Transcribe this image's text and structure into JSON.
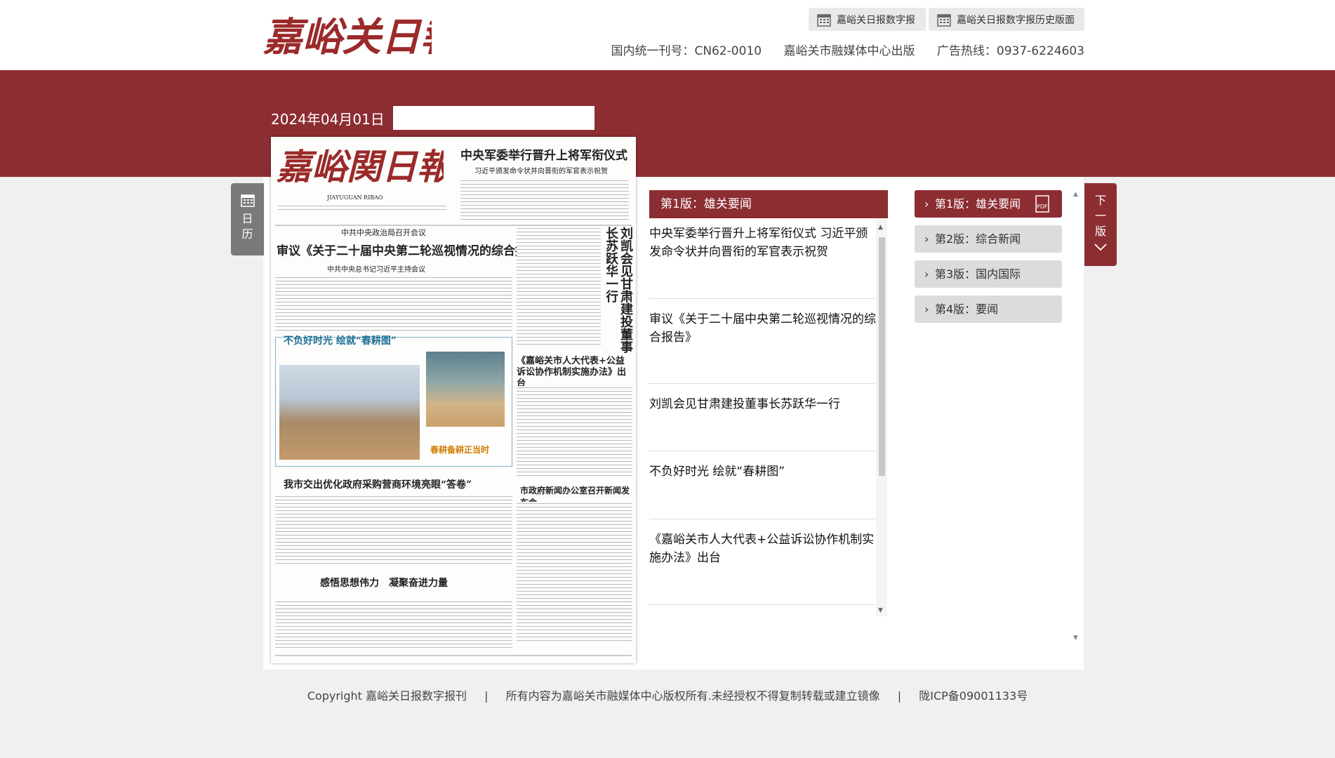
{
  "header": {
    "logo_text": "嘉峪关日報",
    "btn_digital": "嘉峪关日报数字报",
    "btn_history": "嘉峪关日报数字报历史版面",
    "issn": "国内统一刊号：CN62-0010",
    "publisher": "嘉峪关市融媒体中心出版",
    "hotline": "广告热线：0937-6224603"
  },
  "date": "2024年04月01日",
  "side_calendar": {
    "line1": "日",
    "line2": "历"
  },
  "next_page": {
    "line1": "下",
    "line2": "一",
    "line3": "版"
  },
  "paper": {
    "masthead": "嘉峪関日報",
    "pinyin": "JIAYUGUAN RIBAO",
    "headline_top": "中央军委举行晋升上将军衔仪式",
    "sub_top": "习近平颁发命令状并向晋衔的军官表示祝贺",
    "kicker": "中共中央政治局召开会议",
    "headline_main": "审议《关于二十届中央第二轮巡视情况的综合报告》",
    "sub_main": "中共中央总书记习近平主持会议",
    "vertical_head": "刘凯会见甘肃建投董事长苏跃华一行",
    "photo_head": "不负好时光 绘就“春耕图”",
    "spring_label": "春耕备耕正当时",
    "head_law": "《嘉峪关市人大代表+公益诉讼协作机制实施办法》出台",
    "head_procure": "我市交出优化政府采购营商环境亮眼“答卷”",
    "head_news": "市政府新闻办公室召开新闻发布会",
    "head_think": "感悟思想伟力　凝聚奋进力量"
  },
  "section_title": "第1版：雄关要闻",
  "articles": [
    {
      "title": "中央军委举行晋升上将军衔仪式 习近平颁发命令状并向晋衔的军官表示祝贺"
    },
    {
      "title": "审议《关于二十届中央第二轮巡视情况的综合报告》"
    },
    {
      "title": "刘凯会见甘肃建投董事长苏跃华一行"
    },
    {
      "title": "不负好时光 绘就“春耕图”"
    },
    {
      "title": "《嘉峪关市人大代表+公益诉讼协作机制实施办法》出台"
    }
  ],
  "editions": [
    {
      "label": "第1版：雄关要闻",
      "active": true
    },
    {
      "label": "第2版：综合新闻",
      "active": false
    },
    {
      "label": "第3版：国内国际",
      "active": false
    },
    {
      "label": "第4版：要闻",
      "active": false
    }
  ],
  "pdf_label": "PDF",
  "footer": {
    "copyright": "Copyright 嘉峪关日报数字报刊",
    "rights": "所有内容为嘉峪关市融媒体中心版权所有.未经授权不得复制转载或建立镜像",
    "icp": "陇ICP备09001133号",
    "sep": "|"
  },
  "colors": {
    "brand": "#8c2d32",
    "band": "#8c2d32"
  }
}
